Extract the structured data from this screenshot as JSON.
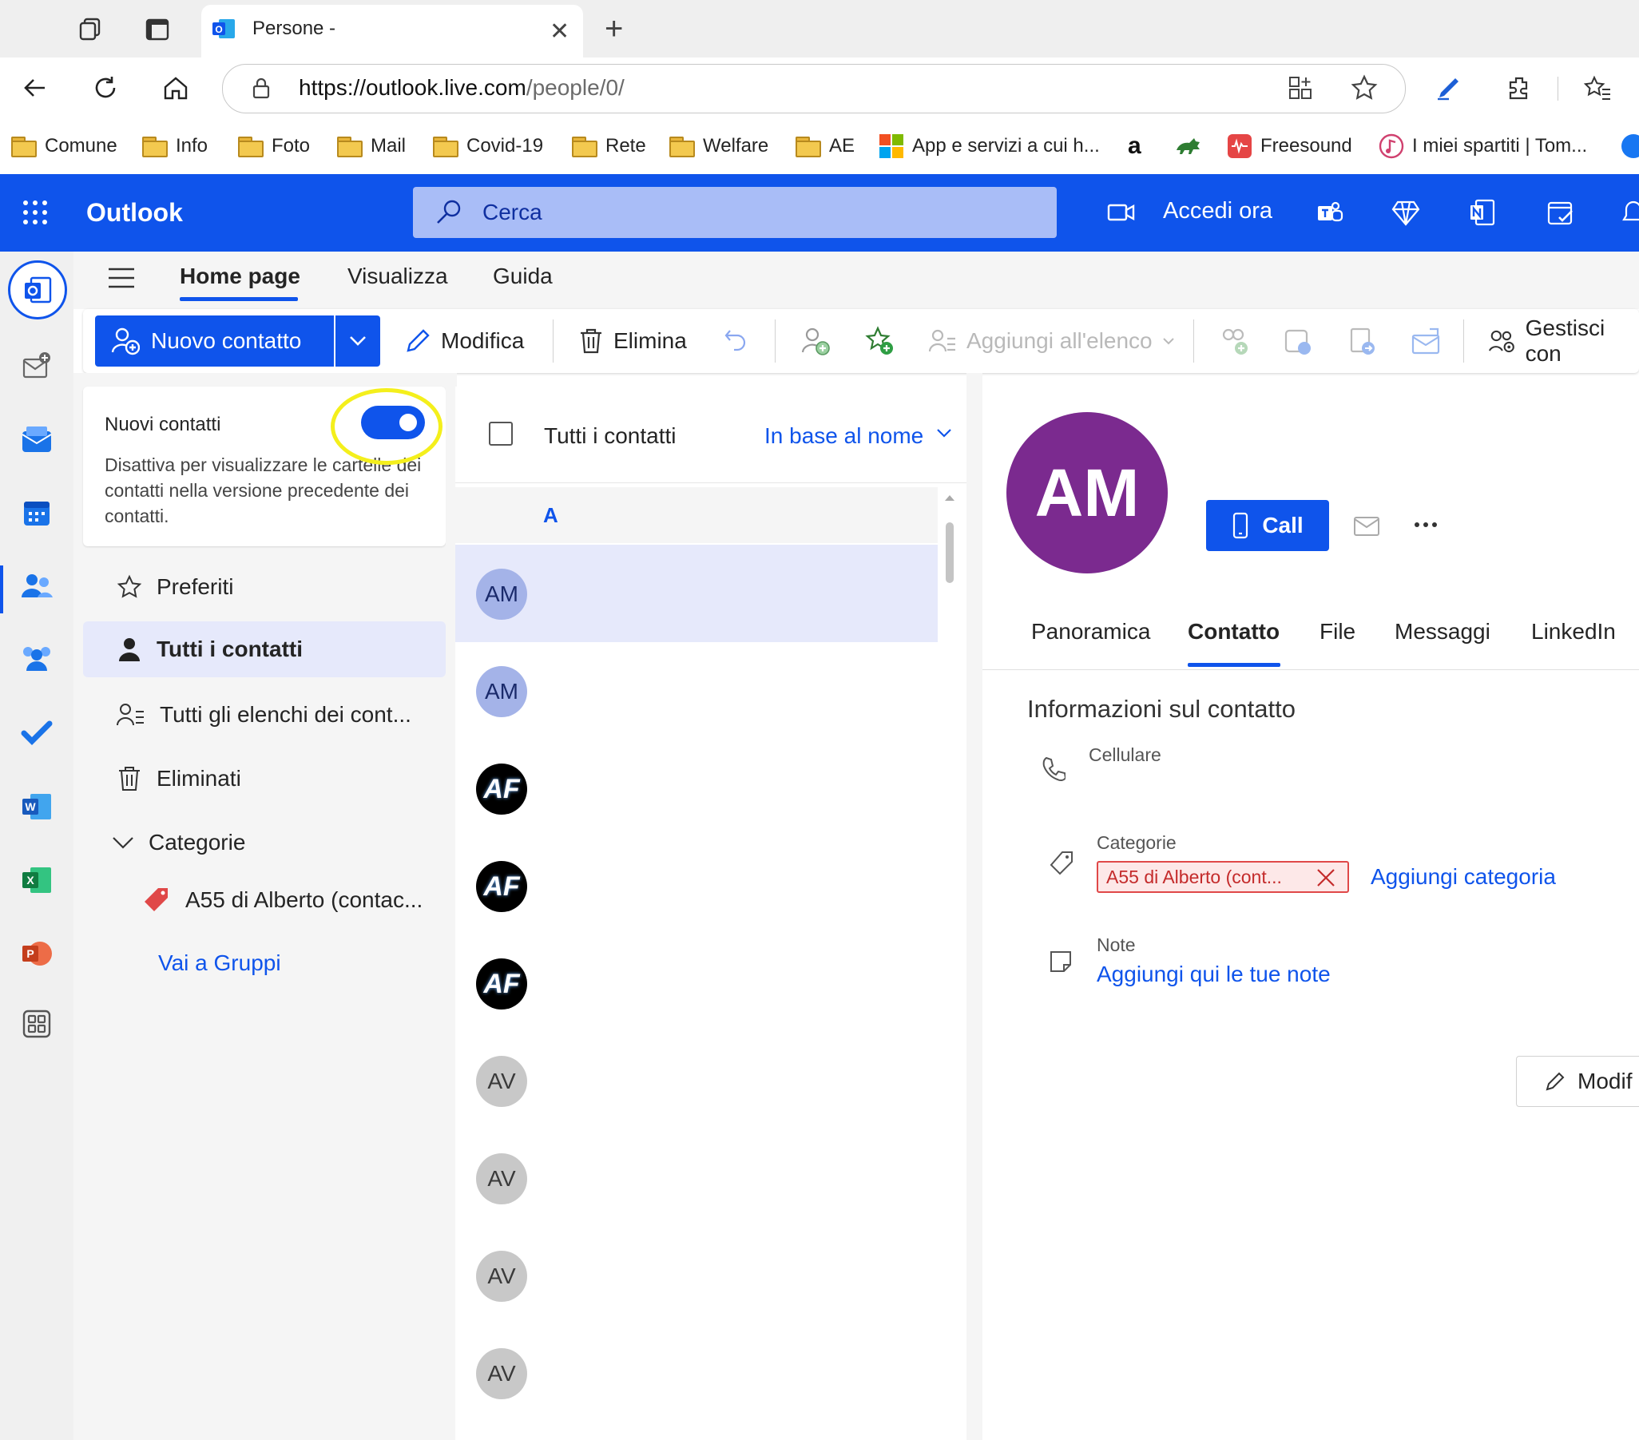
{
  "browser": {
    "tab_title": "Persone -",
    "url_host": "https://outlook.live.com",
    "url_path": "/people/0/",
    "bookmarks": [
      "Comune",
      "Info",
      "Foto",
      "Mail",
      "Covid-19",
      "Rete",
      "Welfare",
      "AE",
      "App e servizi a cui h...",
      "a",
      "Freesound",
      "I miei spartiti | Tom..."
    ]
  },
  "header": {
    "app_name": "Outlook",
    "search_placeholder": "Cerca",
    "meet_now": "Accedi ora"
  },
  "ribbon": {
    "tabs": [
      "Home page",
      "Visualizza",
      "Guida"
    ],
    "new_contact": "Nuovo contatto",
    "edit": "Modifica",
    "delete": "Elimina",
    "add_to_list": "Aggiungi all'elenco",
    "manage": "Gestisci con"
  },
  "left": {
    "toggle_title": "Nuovi contatti",
    "toggle_desc": "Disattiva per visualizzare le cartelle dei contatti nella versione precedente dei contatti.",
    "toggle_on": true,
    "favorites": "Preferiti",
    "all_contacts": "Tutti i contatti",
    "all_lists": "Tutti gli elenchi dei cont...",
    "deleted": "Eliminati",
    "categories": "Categorie",
    "category_item": "A55 di Alberto (contac...",
    "groups_link": "Vai a Gruppi"
  },
  "list": {
    "header": "Tutti i contatti",
    "sort": "In base al nome",
    "section_letter": "A",
    "contacts": [
      "AM",
      "AM",
      "AF",
      "AF",
      "AF",
      "AV",
      "AV",
      "AV",
      "AV"
    ]
  },
  "detail": {
    "initials": "AM",
    "call": "Call",
    "tabs": [
      "Panoramica",
      "Contatto",
      "File",
      "Messaggi",
      "LinkedIn"
    ],
    "active_tab": "Contatto",
    "section_title": "Informazioni sul contatto",
    "mobile_label": "Cellulare",
    "categories_label": "Categorie",
    "category_chip": "A55 di Alberto (cont...",
    "add_category": "Aggiungi categoria",
    "notes_label": "Note",
    "add_notes": "Aggiungi qui le tue note",
    "edit_button": "Modif"
  },
  "colors": {
    "brand": "#0f54eb",
    "avatar_purple": "#7b2a8f",
    "selected_row": "#e6e9fb",
    "highlight_circle": "#f4ef1c"
  }
}
